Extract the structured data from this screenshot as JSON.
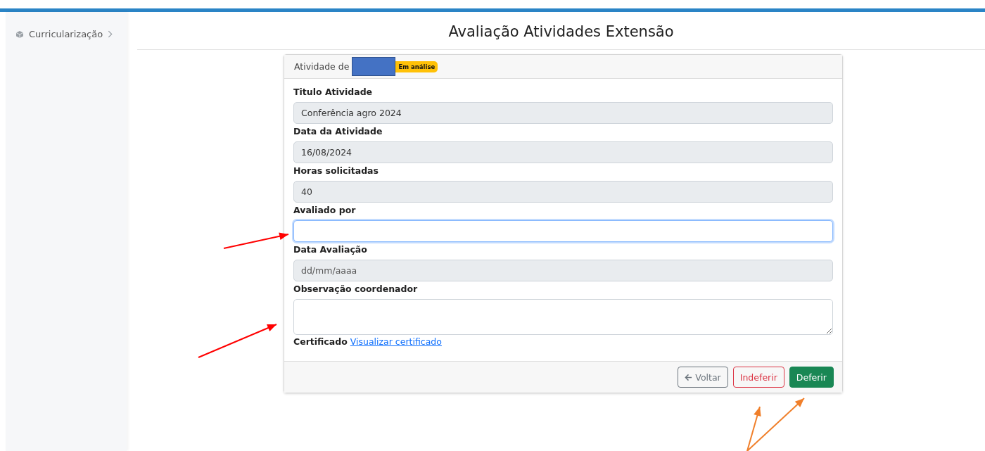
{
  "sidebar": {
    "items": [
      {
        "label": "Curricularização",
        "expanded": false
      }
    ]
  },
  "page_title": "Avaliação Atividades Extensão",
  "card": {
    "header_label": "Atividade de",
    "redacted": true,
    "status_badge": "Em análise",
    "fields": [
      {
        "kind": "input",
        "label": "Titulo Atividade",
        "value": "Conferência agro 2024",
        "disabled": true,
        "focused": false
      },
      {
        "kind": "input",
        "label": "Data da Atividade",
        "value": "16/08/2024",
        "disabled": true,
        "focused": false
      },
      {
        "kind": "input",
        "label": "Horas solicitadas",
        "value": "40",
        "disabled": true,
        "focused": false
      },
      {
        "kind": "input",
        "label": "Avaliado por",
        "disabled": false,
        "focused": true
      },
      {
        "kind": "input",
        "label": "Data Avaliação",
        "placeholder": "dd/mm/aaaa",
        "disabled": true,
        "focused": false
      },
      {
        "kind": "textarea",
        "label": "Observação coordenador",
        "disabled": false,
        "focused": false
      }
    ],
    "certificate_label": "Certificado",
    "certificate_link": "Visualizar certificado",
    "buttons": [
      {
        "kind": "back",
        "label": "Voltar"
      },
      {
        "kind": "danger",
        "label": "Indeferir"
      },
      {
        "kind": "success",
        "label": "Deferir"
      }
    ]
  },
  "annotations": [
    {
      "kind": "arrow",
      "color": "#ff0000"
    },
    {
      "kind": "arrow",
      "color": "#ff0000"
    },
    {
      "kind": "arrow",
      "color": "#f07f2a"
    },
    {
      "kind": "arrow",
      "color": "#f07f2a"
    }
  ]
}
